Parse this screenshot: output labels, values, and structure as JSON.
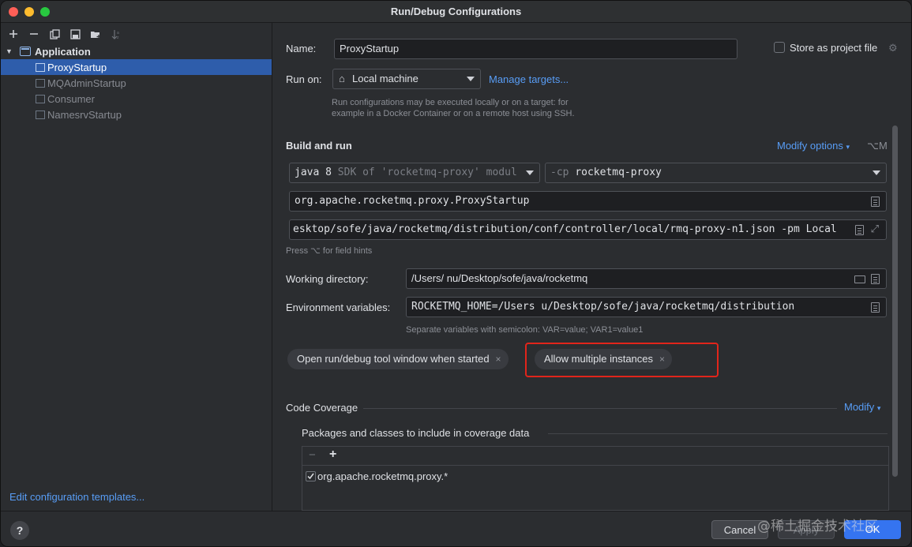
{
  "window": {
    "title": "Run/Debug Configurations"
  },
  "toolbar": {
    "icons": [
      "add-icon",
      "remove-icon",
      "copy-icon",
      "save-icon",
      "folder-add-icon",
      "sort-icon"
    ]
  },
  "tree": {
    "group_label": "Application",
    "items": [
      {
        "label": "ProxyStartup",
        "selected": true
      },
      {
        "label": "MQAdminStartup",
        "selected": false
      },
      {
        "label": "Consumer",
        "selected": false
      },
      {
        "label": "NamesrvStartup",
        "selected": false
      }
    ],
    "edit_templates_link": "Edit configuration templates..."
  },
  "form": {
    "name_label": "Name:",
    "name_value": "ProxyStartup",
    "store_label": "Store as project file",
    "run_on_label": "Run on:",
    "run_on_value": "Local machine",
    "manage_targets": "Manage targets...",
    "run_on_hint_1": "Run configurations may be executed locally or on a target: for",
    "run_on_hint_2": "example in a Docker Container or on a remote host using SSH.",
    "build_title": "Build and run",
    "modify_options": "Modify options",
    "modify_shortcut": "⌥M",
    "jdk_value": "java 8",
    "jdk_hint": "SDK of 'rocketmq-proxy' modul",
    "cp_prefix": "-cp",
    "cp_value": "rocketmq-proxy",
    "main_class": "org.apache.rocketmq.proxy.ProxyStartup",
    "program_args": "esktop/sofe/java/rocketmq/distribution/conf/controller/local/rmq-proxy-n1.json -pm Local",
    "field_hint": "Press ⌥ for field hints",
    "workdir_label": "Working directory:",
    "workdir_value": "/Users/     nu/Desktop/sofe/java/rocketmq",
    "env_label": "Environment variables:",
    "env_value": "ROCKETMQ_HOME=/Users      u/Desktop/sofe/java/rocketmq/distribution",
    "env_hint": "Separate variables with semicolon: VAR=value; VAR1=value1",
    "chip_open_tool": "Open run/debug tool window when started",
    "chip_allow_multiple": "Allow multiple instances",
    "chip_close": "×",
    "coverage_title": "Code Coverage",
    "coverage_modify": "Modify",
    "coverage_packages_label": "Packages and classes to include in coverage data",
    "coverage_minus": "−",
    "coverage_add": "+",
    "coverage_entry": "org.apache.rocketmq.proxy.*"
  },
  "buttons": {
    "help": "?",
    "cancel": "Cancel",
    "apply": "Apply",
    "ok": "OK"
  },
  "watermark": "@稀土掘金技术社区",
  "colors": {
    "selection": "#2e5dab",
    "link": "#589df6",
    "highlight": "#e1251b",
    "ok_button": "#3574f0"
  }
}
